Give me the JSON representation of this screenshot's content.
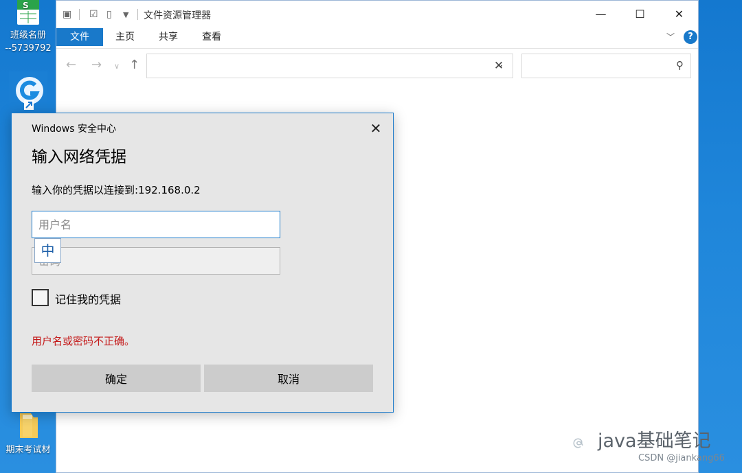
{
  "desktop": {
    "icons": [
      {
        "name": "spreadsheet-icon",
        "label": "班级名册",
        "sublabel": "--5739792"
      },
      {
        "name": "app-shortcut-icon",
        "label": ""
      },
      {
        "name": "folder-icon",
        "label": "期末考试材"
      }
    ]
  },
  "explorer": {
    "title": "文件资源管理器",
    "ribbon_tabs": [
      "文件",
      "主页",
      "共享",
      "查看"
    ],
    "address_value": "",
    "search_placeholder": ""
  },
  "dialog": {
    "caption": "Windows 安全中心",
    "heading": "输入网络凭据",
    "subtext": "输入你的凭据以连接到:192.168.0.2",
    "username_placeholder": "用户名",
    "password_placeholder": "密码",
    "ime_indicator": "中",
    "remember_label": "记住我的凭据",
    "remember_checked": false,
    "error_text": "用户名或密码不正确。",
    "ok_label": "确定",
    "cancel_label": "取消"
  },
  "watermark": {
    "main": "java基础笔记",
    "csdn": "CSDN @jiankang66"
  },
  "colors": {
    "accent": "#1979ca",
    "error": "#c41818",
    "desktop": "#1a7fd4"
  }
}
